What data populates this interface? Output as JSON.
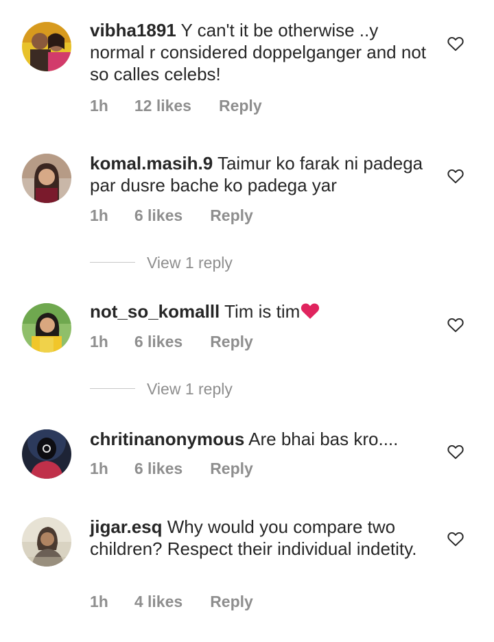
{
  "comments": [
    {
      "username": "vibha1891",
      "text": "Y can't it be otherwise ..y normal r considered doppelganger and not so calles celebs!",
      "time": "1h",
      "likes": "12 likes",
      "reply_label": "Reply"
    },
    {
      "username": "komal.masih.9",
      "text": "Taimur ko farak ni padega par dusre bache ko padega yar",
      "time": "1h",
      "likes": "6 likes",
      "reply_label": "Reply",
      "view_replies": "View 1 reply"
    },
    {
      "username": "not_so_komalll",
      "text": "Tim is tim",
      "emoji": "red-heart",
      "time": "1h",
      "likes": "6 likes",
      "reply_label": "Reply",
      "view_replies": "View 1 reply"
    },
    {
      "username": "chritinanonymous",
      "text": "Are bhai bas kro....",
      "time": "1h",
      "likes": "6 likes",
      "reply_label": "Reply"
    },
    {
      "username": "jigar.esq",
      "text": "Why would you compare two children? Respect their individual indetity.",
      "time": "1h",
      "likes": "4 likes",
      "reply_label": "Reply"
    }
  ],
  "colors": {
    "text": "#262626",
    "meta": "#8e8e8e",
    "divider": "#c7c7c7",
    "emoji_heart": "#e0245e"
  },
  "icons": {
    "like": "heart-outline-icon",
    "emoji": "red-heart-emoji"
  }
}
